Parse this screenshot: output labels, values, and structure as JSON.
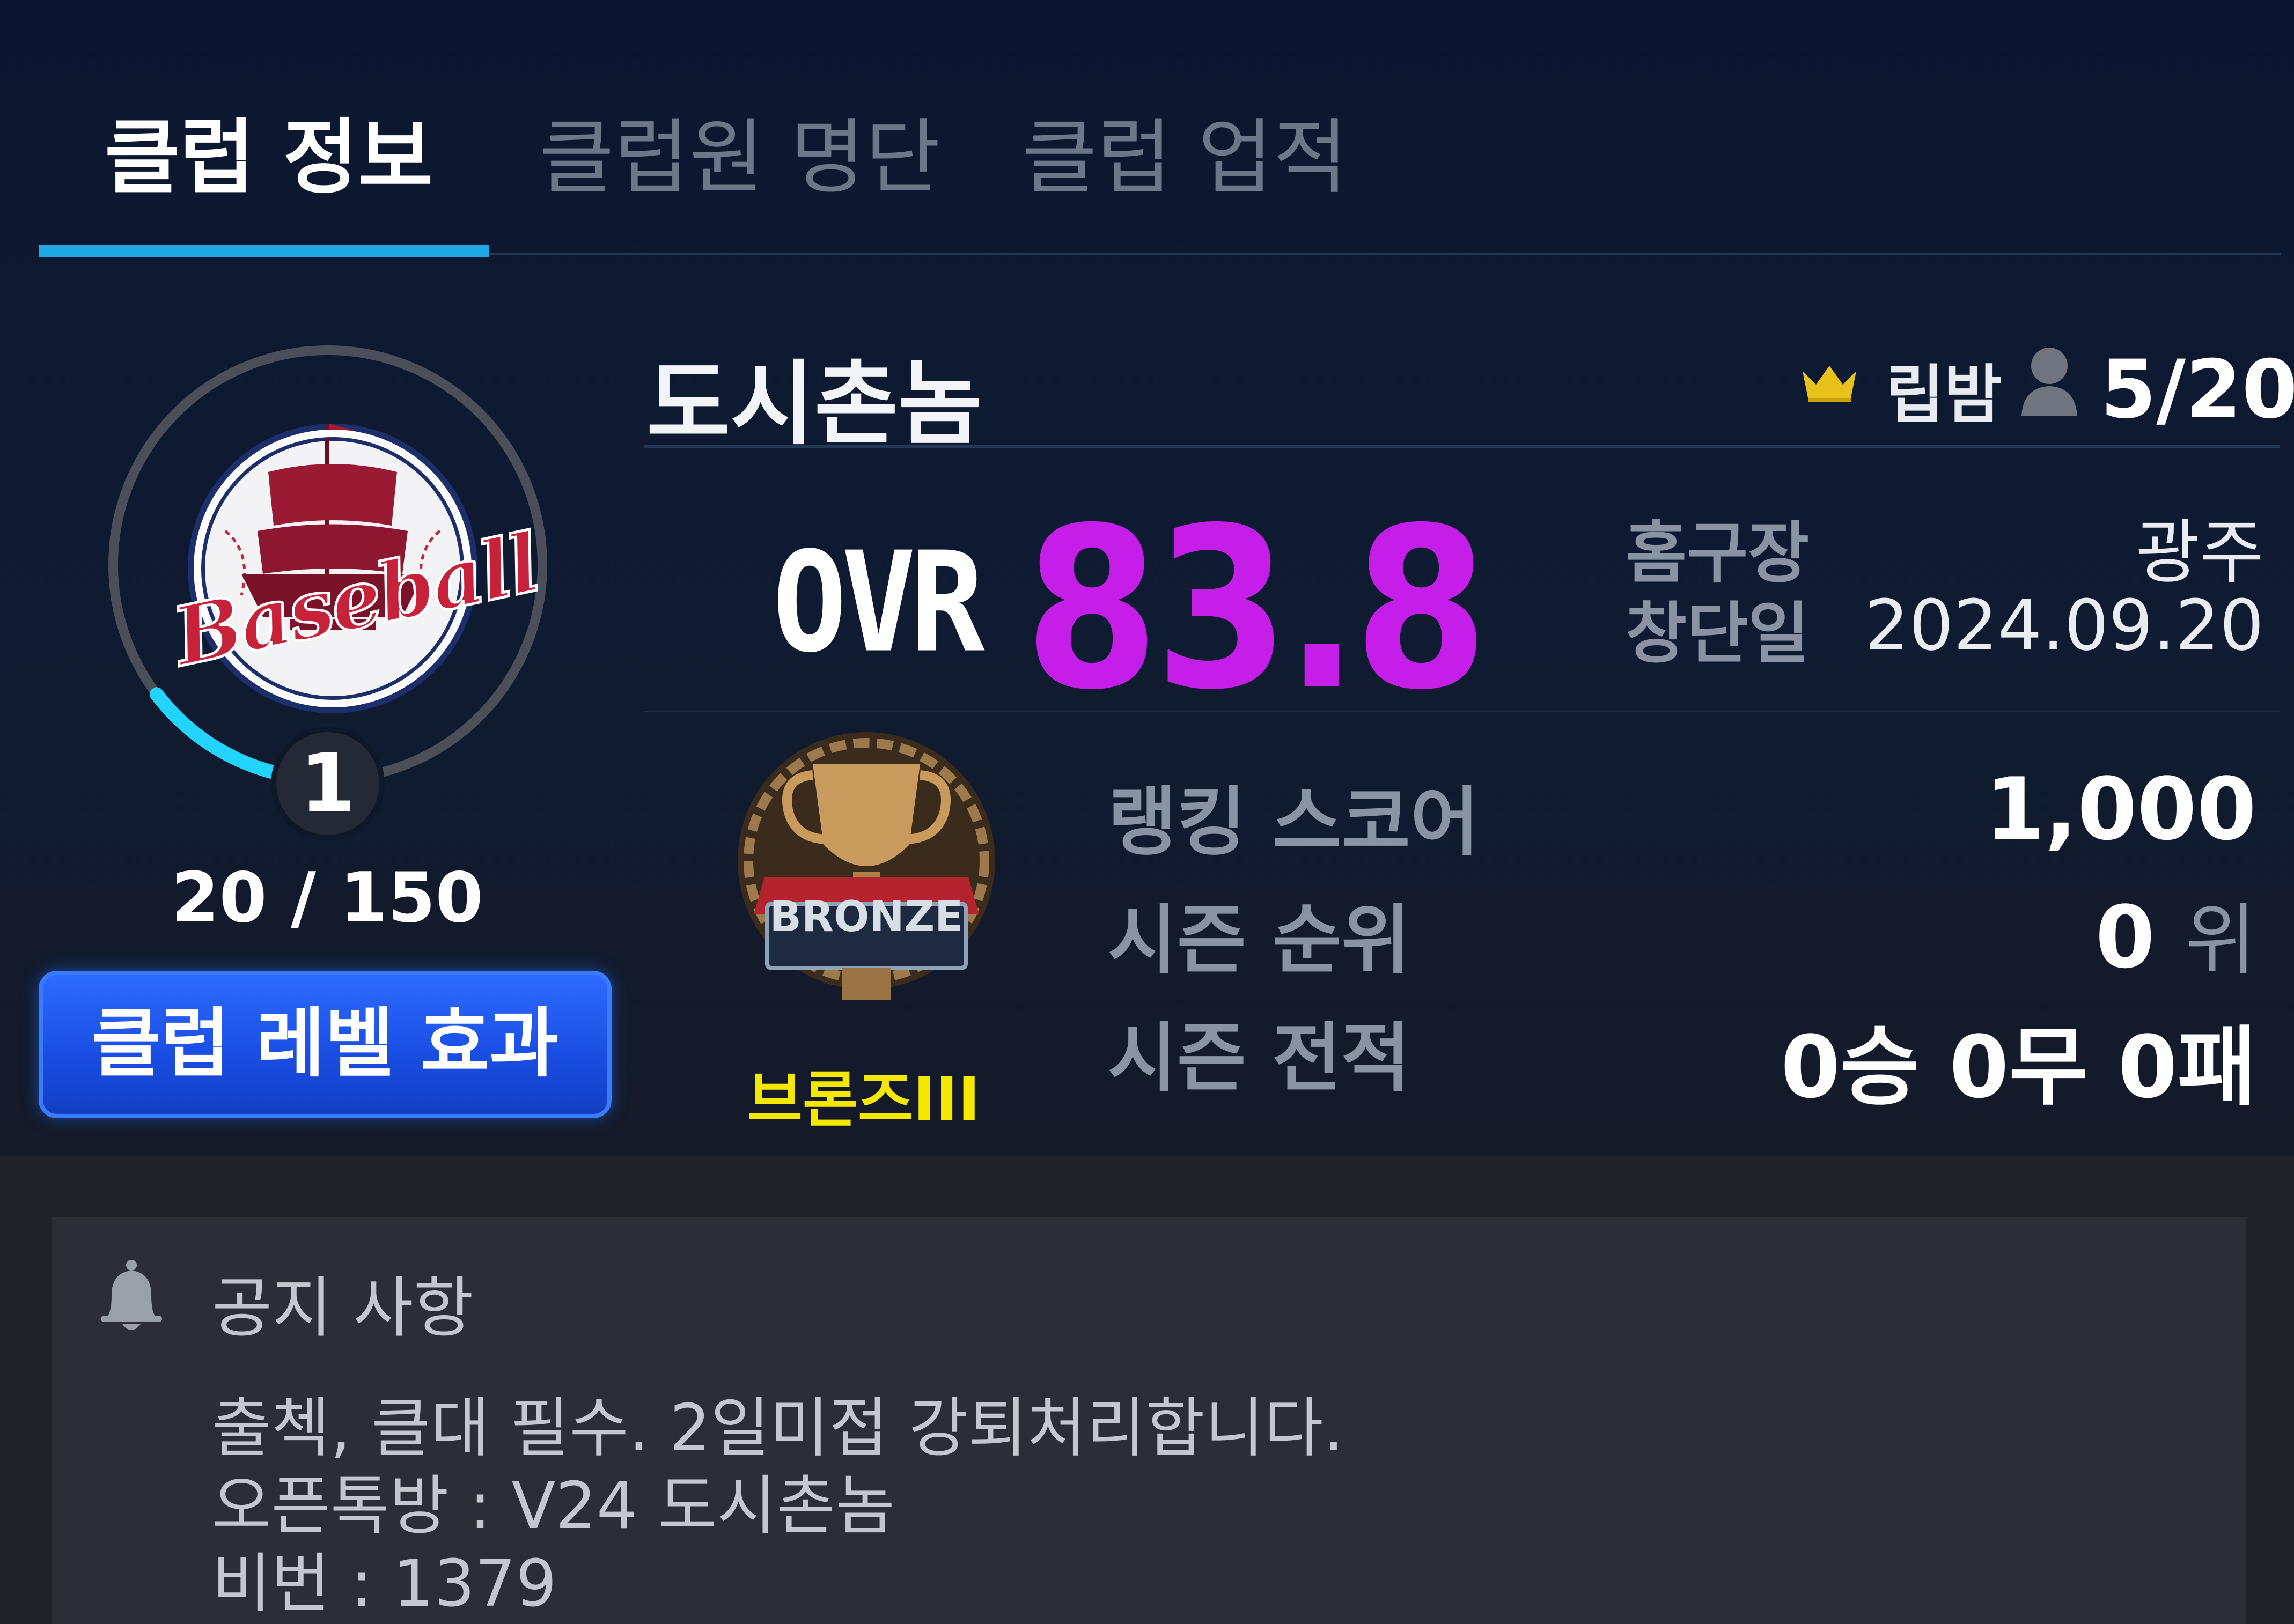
{
  "tabs": [
    {
      "label": "클럽 정보",
      "active": true
    },
    {
      "label": "클럽원 명단",
      "active": false
    },
    {
      "label": "클럽 업적",
      "active": false
    }
  ],
  "club": {
    "name": "도시촌놈",
    "leader": "립밤",
    "members": "5/20",
    "ovr_label": "OVR",
    "ovr": "83.8",
    "stadium_label": "홈구장",
    "stadium": "광주",
    "founded_label": "창단일",
    "founded": "2024.09.20",
    "emblem_text": "Baseball"
  },
  "level": {
    "value": "1",
    "progress_text": "20 / 150",
    "progress_fraction": 0.133,
    "button_label": "클럽 레벨 효과"
  },
  "ranking": {
    "tier_emblem_text": "BRONZE",
    "tier_name": "브론즈III",
    "score_label": "랭킹 스코어",
    "score": "1,000",
    "season_rank_label": "시즌 순위",
    "season_rank": "0",
    "season_rank_unit": "위",
    "season_record_label": "시즌 전적",
    "season_record": "0승 0무 0패"
  },
  "notice": {
    "title": "공지 사항",
    "lines": [
      "출첵, 클대 필수. 2일미접 강퇴처리합니다.",
      "오픈톡방 : V24 도시촌놈",
      "비번 : 1379"
    ]
  },
  "colors": {
    "accent": "#1fa8e6",
    "ovr": "#c41ee8",
    "tier": "#f4e800",
    "button": "#1f55e8"
  },
  "icons": {
    "crown": "crown-icon",
    "member": "person-icon",
    "notice": "bell-icon"
  }
}
